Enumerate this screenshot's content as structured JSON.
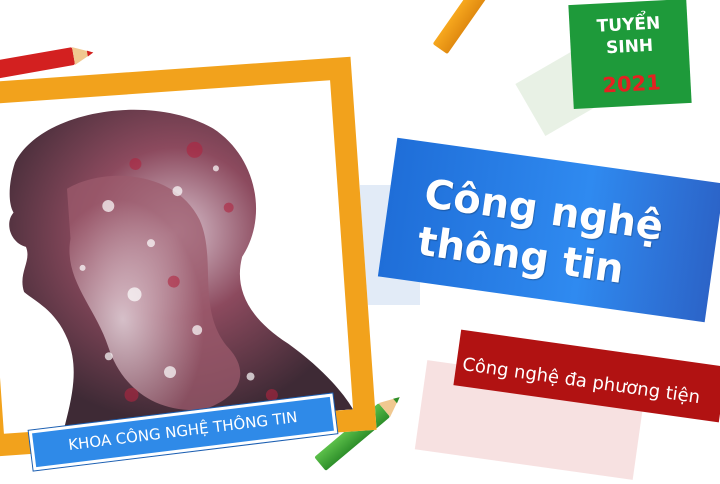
{
  "tag": {
    "line1": "TUYỂN",
    "line2": "SINH",
    "year": "2021"
  },
  "banner": {
    "title": "Công nghệ thông tin",
    "subtitle": "Công nghệ đa phương tiện"
  },
  "faculty": {
    "label": "KHOA CÔNG NGHỆ THÔNG TIN"
  },
  "colors": {
    "frame": "#f2a21c",
    "tag_bg": "#1e9a3a",
    "tag_year": "#e52121",
    "banner_blue": "#2f8af0",
    "banner_red": "#b11212"
  },
  "icons": [
    "red-pencil-icon",
    "orange-pencil-icon",
    "green-pencil-icon"
  ]
}
